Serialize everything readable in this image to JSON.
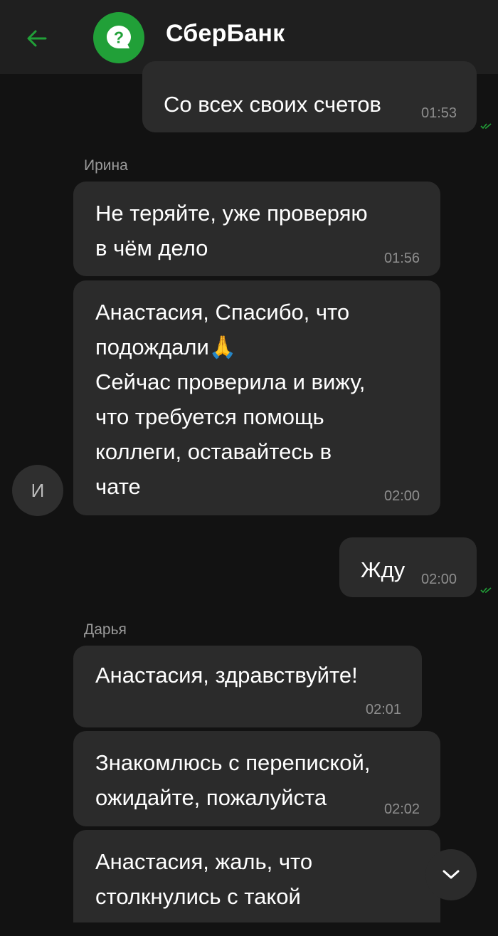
{
  "header": {
    "title": "СберБанк",
    "back_icon": "arrow-left-icon",
    "logo_icon": "question-chat-icon",
    "accent": "#21a038"
  },
  "messages": [
    {
      "type": "out",
      "text": "Со всех своих счетов",
      "time": "01:53"
    },
    {
      "type": "sender",
      "name": "Ирина"
    },
    {
      "type": "in",
      "text": "Не теряйте, уже проверяю\nв чём дело",
      "time": "01:56"
    },
    {
      "type": "in",
      "text": "Анастасия, Спасибо, что\nподождали🙏\nСейчас проверила и вижу,\nчто требуется помощь\nколлеги, оставайтесь в\nчате",
      "time": "02:00"
    },
    {
      "type": "out",
      "text": "Жду",
      "time": "02:00"
    },
    {
      "type": "sender",
      "name": "Дарья"
    },
    {
      "type": "in",
      "text": "Анастасия, здравствуйте!",
      "time": "02:01"
    },
    {
      "type": "in",
      "text": "Знакомлюсь с перепиской,\nожидайте, пожалуйста",
      "time": "02:02"
    },
    {
      "type": "in",
      "text": "Анастасия, жаль, что\nстолкнулись с такой",
      "time": ""
    }
  ],
  "avatar": {
    "initial": "И"
  },
  "scroll_button": {
    "icon": "chevron-down-icon"
  }
}
